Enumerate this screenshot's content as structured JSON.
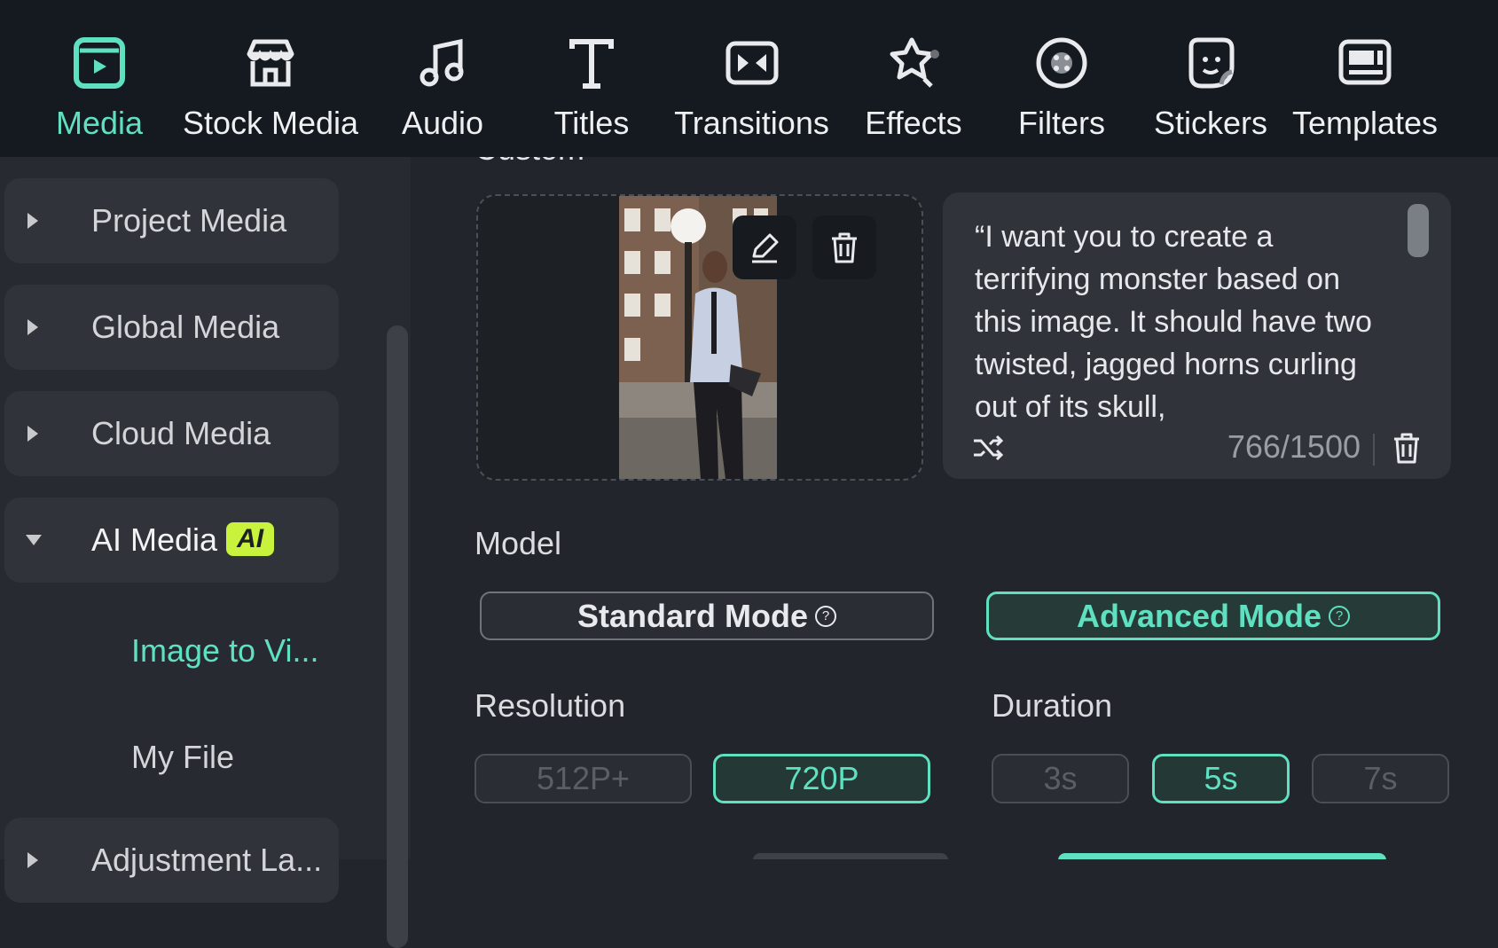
{
  "toolbar": {
    "items": [
      {
        "label": "Media",
        "icon": "media-icon",
        "active": true
      },
      {
        "label": "Stock Media",
        "icon": "store-icon"
      },
      {
        "label": "Audio",
        "icon": "music-note-icon"
      },
      {
        "label": "Titles",
        "icon": "text-t-icon"
      },
      {
        "label": "Transitions",
        "icon": "transition-icon"
      },
      {
        "label": "Effects",
        "icon": "effects-star-icon"
      },
      {
        "label": "Filters",
        "icon": "filter-circle-icon"
      },
      {
        "label": "Stickers",
        "icon": "sticker-icon"
      },
      {
        "label": "Templates",
        "icon": "template-icon"
      }
    ]
  },
  "sidebar": {
    "items": [
      {
        "label": "Project Media"
      },
      {
        "label": "Global Media"
      },
      {
        "label": "Cloud Media"
      },
      {
        "label": "AI Media",
        "badge": "AI"
      },
      {
        "label": "Adjustment La..."
      }
    ],
    "sub_items": [
      {
        "label": "Image to Vi...",
        "active": true
      },
      {
        "label": "My File"
      }
    ]
  },
  "main": {
    "section_title": "Custom",
    "prompt": {
      "text": "“I want you to create a terrifying monster based on this image. It should have two twisted, jagged horns curling out of its skull,",
      "count": "766/1500"
    },
    "model": {
      "label": "Model",
      "standard": "Standard Mode",
      "advanced": "Advanced Mode",
      "help_glyph": "?"
    },
    "resolution": {
      "label": "Resolution",
      "options": [
        "512P+",
        "720P"
      ]
    },
    "duration": {
      "label": "Duration",
      "options": [
        "3s",
        "5s",
        "7s"
      ]
    }
  },
  "colors": {
    "accent": "#5fe0c0",
    "toolbar_bg": "#151a20",
    "panel_bg": "#22252b",
    "ai_badge": "#c8f23c"
  }
}
